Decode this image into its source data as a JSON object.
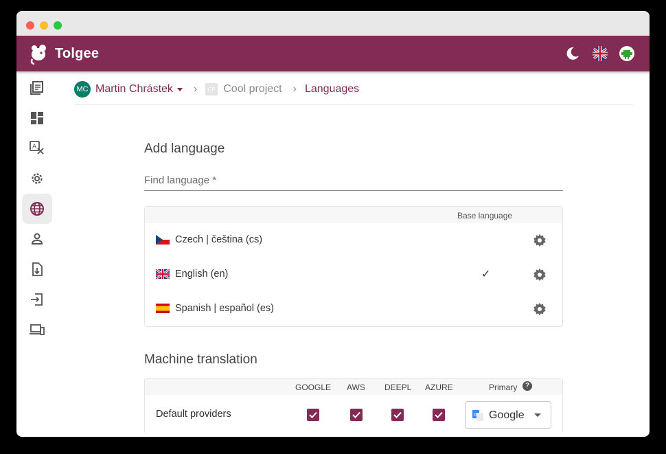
{
  "app": {
    "brand": "Tolgee"
  },
  "breadcrumb": {
    "owner_initials": "MC",
    "owner": "Martin Chrástek",
    "project_initials": "CP",
    "project": "Cool project",
    "current": "Languages",
    "separator": "›"
  },
  "sidebar": {
    "items": [
      {
        "icon": "translations-icon"
      },
      {
        "icon": "dashboard-icon"
      },
      {
        "icon": "translate-icon"
      },
      {
        "icon": "settings-icon"
      },
      {
        "icon": "language-icon",
        "active": true
      },
      {
        "icon": "members-icon"
      },
      {
        "icon": "import-icon"
      },
      {
        "icon": "export-icon"
      },
      {
        "icon": "integrate-icon"
      }
    ]
  },
  "add_language": {
    "title": "Add language",
    "find_placeholder": "Find language *",
    "base_language_header": "Base language",
    "languages": [
      {
        "name": "Czech | čeština (cs)",
        "flag": "cz",
        "base": false
      },
      {
        "name": "English (en)",
        "flag": "gb",
        "base": true
      },
      {
        "name": "Spanish | español (es)",
        "flag": "es",
        "base": false
      }
    ],
    "base_check": "✓"
  },
  "machine_translation": {
    "title": "Machine translation",
    "columns": [
      "GOOGLE",
      "AWS",
      "DEEPL",
      "AZURE"
    ],
    "primary_header": "Primary",
    "help_icon": "?",
    "rows": [
      {
        "label": "Default providers",
        "checked": [
          true,
          true,
          true,
          true
        ],
        "primary": "Google"
      }
    ]
  },
  "colors": {
    "brand": "#822b55",
    "avatar": "#0e7c6b"
  }
}
